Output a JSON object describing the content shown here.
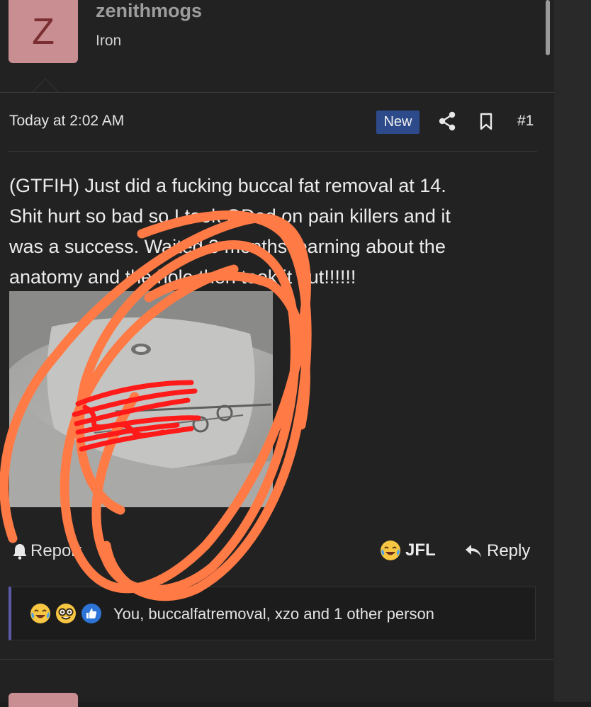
{
  "post": {
    "author": {
      "avatar_letter": "Z",
      "username": "zenithmogs",
      "title": "Iron",
      "avatar_color": "#c98e91"
    },
    "timestamp": "Today at 2:02 AM",
    "new_badge": "New",
    "post_number": "#1",
    "body_lines": [
      "(GTFIH) Just did a fucking buccal fat removal at 14.",
      "Shit hurt so bad so I took ODed on pain killers and it",
      "was a success. Waited 3 months learning about the",
      "anatomy and the hole then took it out!!!!!!"
    ],
    "actions": {
      "report_label": "Report",
      "jfl_label": "JFL",
      "reply_label": "Reply"
    },
    "reactions": {
      "icons": [
        "tears-of-joy-emoji",
        "nerd-emoji",
        "like-icon"
      ],
      "summary": "You, buccalfatremoval, xzo and 1 other person"
    }
  },
  "colors": {
    "background": "#222223",
    "new_badge": "#2d4b8a",
    "reaction_accent": "#5a5aa8",
    "annotation_orange": "#ff7a45",
    "annotation_red": "#ff1a1a"
  }
}
